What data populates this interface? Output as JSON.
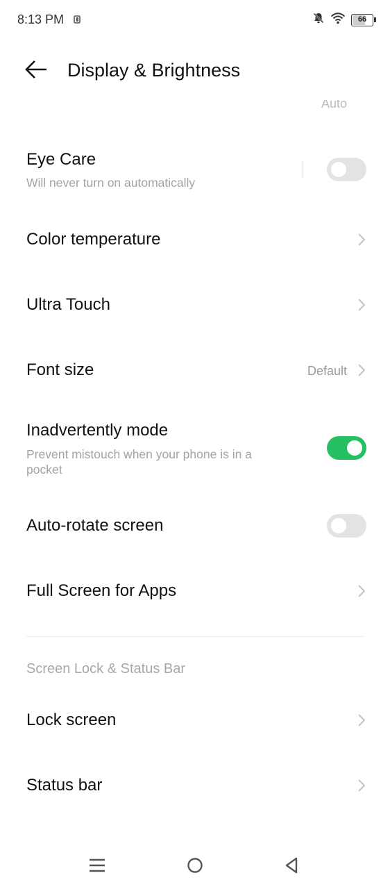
{
  "status_bar": {
    "time": "8:13 PM",
    "battery": "66",
    "battery_level": 0.66,
    "icons": [
      "notification-app-icon",
      "bell-off-icon",
      "wifi-icon",
      "battery-icon"
    ]
  },
  "header": {
    "title": "Display & Brightness",
    "back_icon": "arrow-left-icon"
  },
  "clipped_previous_value": "Auto",
  "settings": {
    "eye_care": {
      "title": "Eye Care",
      "subtitle": "Will never turn on automatically",
      "enabled": false
    },
    "color_temperature": {
      "title": "Color temperature"
    },
    "ultra_touch": {
      "title": "Ultra Touch"
    },
    "font_size": {
      "title": "Font size",
      "value": "Default"
    },
    "inadvertently_mode": {
      "title": "Inadvertently mode",
      "subtitle": "Prevent mistouch when your phone is in a pocket",
      "enabled": true
    },
    "auto_rotate": {
      "title": "Auto-rotate screen",
      "enabled": false
    },
    "full_screen_apps": {
      "title": "Full Screen for Apps"
    }
  },
  "section_lock": {
    "header": "Screen Lock & Status Bar",
    "lock_screen": {
      "title": "Lock screen"
    },
    "status_bar_item": {
      "title": "Status bar"
    }
  },
  "colors": {
    "toggle_on": "#26c062",
    "toggle_off": "#e3e3e3",
    "secondary_text": "#a3a3a3"
  },
  "nav_bar": {
    "icons": [
      "menu-icon",
      "home-circle-icon",
      "back-triangle-icon"
    ]
  }
}
